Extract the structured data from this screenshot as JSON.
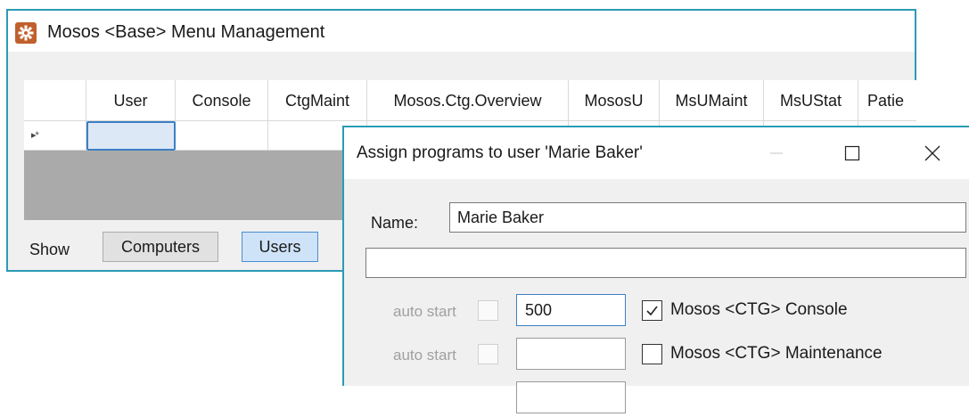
{
  "main_window": {
    "title": "Mosos <Base> Menu Management",
    "grid": {
      "columns": [
        "",
        "User",
        "Console",
        "CtgMaint",
        "Mosos.Ctg.Overview",
        "MososU",
        "MsUMaint",
        "MsUStat",
        "Patie"
      ],
      "new_row_marker": "▸*"
    },
    "show_label": "Show",
    "computers_button": "Computers",
    "users_button": "Users"
  },
  "dialog": {
    "title": "Assign programs to user 'Marie Baker'",
    "name_label": "Name:",
    "name_value": "Marie Baker",
    "programs": [
      {
        "auto_label": "auto start",
        "order": "500",
        "checked": true,
        "label": "Mosos <CTG> Console"
      },
      {
        "auto_label": "auto start",
        "order": "",
        "checked": false,
        "label": "Mosos <CTG> Maintenance"
      },
      {
        "auto_label": "",
        "order": "",
        "checked": false,
        "label": ""
      }
    ]
  },
  "colors": {
    "window_border": "#2b9bb5",
    "selection_blue": "#3c7fc4",
    "users_button_bg": "#cfe3f8",
    "icon_orange": "#c0602d"
  },
  "icons": [
    "gear-icon",
    "minimize-icon",
    "maximize-icon",
    "close-icon",
    "checkmark-icon"
  ]
}
